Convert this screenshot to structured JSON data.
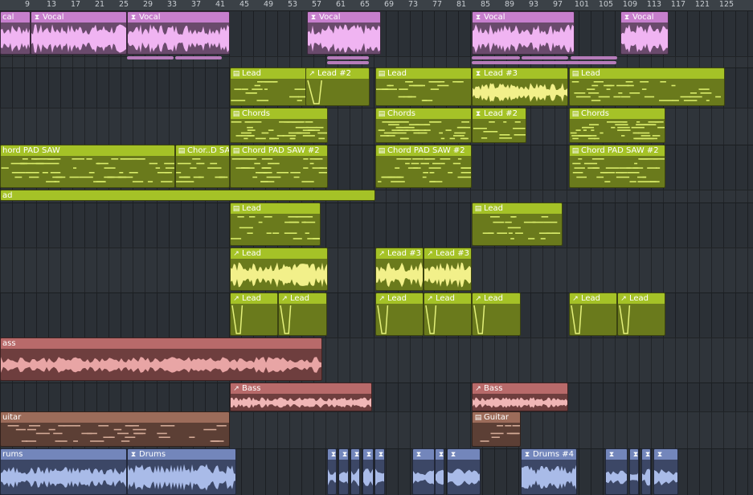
{
  "ruler": {
    "ticks": [
      "9",
      "13",
      "17",
      "21",
      "25",
      "29",
      "33",
      "37",
      "41",
      "45",
      "49",
      "53",
      "57",
      "61",
      "65",
      "69",
      "73",
      "77",
      "81",
      "85",
      "89",
      "93",
      "97",
      "101",
      "105",
      "109",
      "113",
      "117",
      "121",
      "125"
    ]
  },
  "clip_names": {
    "vocal": "Vocal",
    "vocal_cut": "cal",
    "lead": "Lead",
    "lead2": "Lead #2",
    "lead3": "Lead #3",
    "lead_cut": "ad",
    "chords": "Chords",
    "chord_pad": "Chord PAD SAW",
    "chord_pad_cut": "hord PAD SAW",
    "chord_pad2": "Chord PAD SAW #2",
    "chor_d": "Chor..D SAW",
    "bass": "Bass",
    "bass_cut": "ass",
    "guitar": "Guitar",
    "guitar_cut": "uitar",
    "drums": "Drums",
    "drums_cut": "rums",
    "drums4": "Drums #4"
  },
  "colors": {
    "vocal": "#c77fcd",
    "lead": "#a5c227",
    "bass": "#b86a6a",
    "guitar": "#9c6c5a",
    "drums": "#7386bb",
    "lead_wave": "#f2f08a",
    "vocal_wave": "#f0b4f2"
  },
  "icons": {
    "audio_clip": "audio-clip-icon",
    "pattern_clip": "pattern-clip-icon",
    "automation_clip": "automation-clip-icon"
  }
}
